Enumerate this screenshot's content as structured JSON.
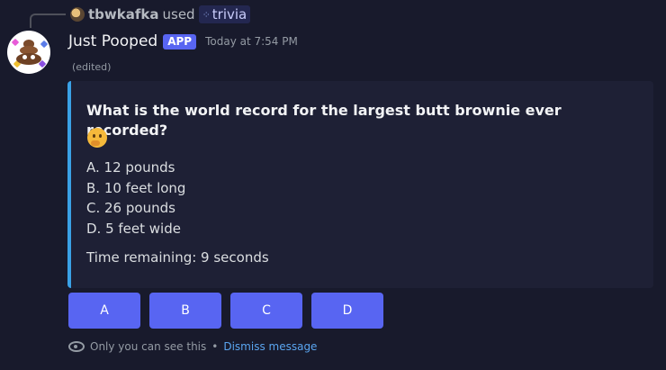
{
  "reply": {
    "user": "tbwkafka",
    "used_text": "used",
    "command_icon": "slash-command-icon",
    "command": "trivia"
  },
  "message": {
    "author": "Just Pooped",
    "badge": "APP",
    "timestamp": "Today at 7:54 PM",
    "edited": "(edited)",
    "avatar_icon": "poop-emoji-avatar"
  },
  "embed": {
    "accent_color": "#3aa1e6",
    "title": "What is the world record for the largest butt brownie ever recorded?",
    "title_emoji": "thinking-face-icon",
    "options": [
      "A. 12 pounds",
      "B. 10 feet long",
      "C. 26 pounds",
      "D. 5 feet wide"
    ],
    "timer": "Time remaining: 9 seconds"
  },
  "buttons": [
    {
      "label": "A"
    },
    {
      "label": "B"
    },
    {
      "label": "C"
    },
    {
      "label": "D"
    }
  ],
  "button_color": "#5865f2",
  "ephemeral": {
    "icon": "eye-icon",
    "note": "Only you can see this",
    "separator": "•",
    "dismiss": "Dismiss message"
  }
}
